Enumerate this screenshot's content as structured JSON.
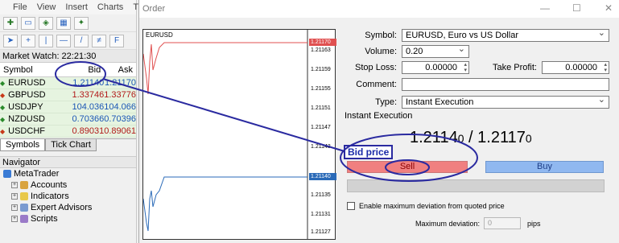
{
  "menu": {
    "items": [
      "File",
      "View",
      "Insert",
      "Charts",
      "T"
    ]
  },
  "market_watch": {
    "title": "Market Watch: 22:21:30",
    "headers": {
      "symbol": "Symbol",
      "bid": "Bid",
      "ask": "Ask"
    },
    "rows": [
      {
        "symbol": "EURUSD",
        "bid": "1.21140",
        "ask": "1.21170",
        "dir": "up"
      },
      {
        "symbol": "GBPUSD",
        "bid": "1.33746",
        "ask": "1.33776",
        "dir": "dn"
      },
      {
        "symbol": "USDJPY",
        "bid": "104.036",
        "ask": "104.066",
        "dir": "up"
      },
      {
        "symbol": "NZDUSD",
        "bid": "0.70366",
        "ask": "0.70396",
        "dir": "up"
      },
      {
        "symbol": "USDCHF",
        "bid": "0.89031",
        "ask": "0.89061",
        "dir": "dn"
      }
    ],
    "tabs": [
      "Symbols",
      "Tick Chart"
    ]
  },
  "navigator": {
    "title": "Navigator",
    "root": "MetaTrader",
    "items": [
      "Accounts",
      "Indicators",
      "Expert Advisors",
      "Scripts"
    ]
  },
  "dialog": {
    "title": "Order",
    "chart": {
      "symbol": "EURUSD",
      "ask_marker": "1.21170",
      "bid_marker": "1.21140",
      "y_labels": [
        "1.21163",
        "1.21159",
        "1.21155",
        "1.21151",
        "1.21147",
        "1.21143",
        "1.21135",
        "1.21131",
        "1.21127"
      ]
    },
    "form": {
      "symbol_label": "Symbol:",
      "symbol_value": "EURUSD, Euro vs US Dollar",
      "volume_label": "Volume:",
      "volume_value": "0.20",
      "stoploss_label": "Stop Loss:",
      "stoploss_value": "0.00000",
      "takeprofit_label": "Take Profit:",
      "takeprofit_value": "0.00000",
      "comment_label": "Comment:",
      "comment_value": "",
      "type_label": "Type:",
      "type_value": "Instant Execution"
    },
    "instant_execution": {
      "title": "Instant Execution",
      "bid_main": "1.2114",
      "bid_small": "0",
      "sep": " / ",
      "ask_main": "1.2117",
      "ask_small": "0",
      "sell_label": "Sell",
      "buy_label": "Buy",
      "deviation_checkbox": "Enable maximum deviation from quoted price",
      "max_deviation_label": "Maximum deviation:",
      "max_deviation_value": "0",
      "pips_label": "pips"
    },
    "annotation": "Bid price"
  },
  "colors": {
    "annotation": "#2a2aa0",
    "sell": "#f08080",
    "buy": "#90b8f0",
    "ask_line": "#e05050",
    "bid_line": "#2a6ab8"
  }
}
